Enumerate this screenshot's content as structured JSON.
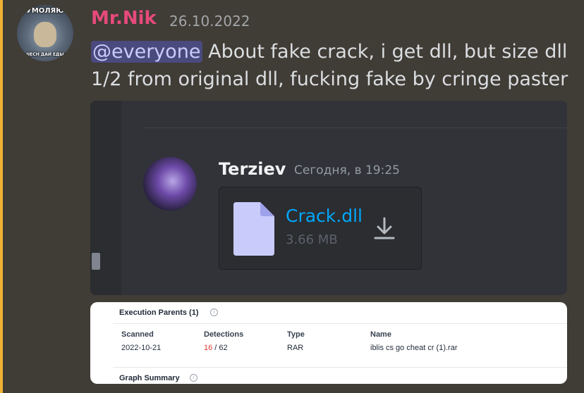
{
  "message": {
    "avatar_text_top": "УМОЛЯЮ",
    "avatar_text_bottom": "ЧЕСН ДАЙ ЕДЫ",
    "username": "Mr.Nik",
    "timestamp": "26.10.2022",
    "mention": "@everyone",
    "text": " About fake crack, i get dll, but size dll 1/2 from original dll, fucking fake by cringe paster",
    "colors": {
      "username": "#e64a7b",
      "mention_bg": "#4a4a7e",
      "highlight_bar": "#f0b232"
    }
  },
  "embed_screenshot": {
    "author": "Terziev",
    "time": "Сегодня, в 19:25",
    "file_name": "Crack.dll",
    "file_size": "3.66 MB",
    "file_icon": "file-icon",
    "download_icon": "download-icon",
    "link_color": "#00a8fc"
  },
  "vt_card": {
    "section_title": "Execution Parents (1)",
    "info_icon": "info-icon",
    "columns": [
      "Scanned",
      "Detections",
      "Type",
      "Name"
    ],
    "rows": [
      {
        "scanned": "2022-10-21",
        "detections_hit": "16",
        "detections_total": " / 62",
        "type": "RAR",
        "name": "iblis cs go cheat cr (1).rar"
      }
    ],
    "footer_title": "Graph Summary"
  }
}
